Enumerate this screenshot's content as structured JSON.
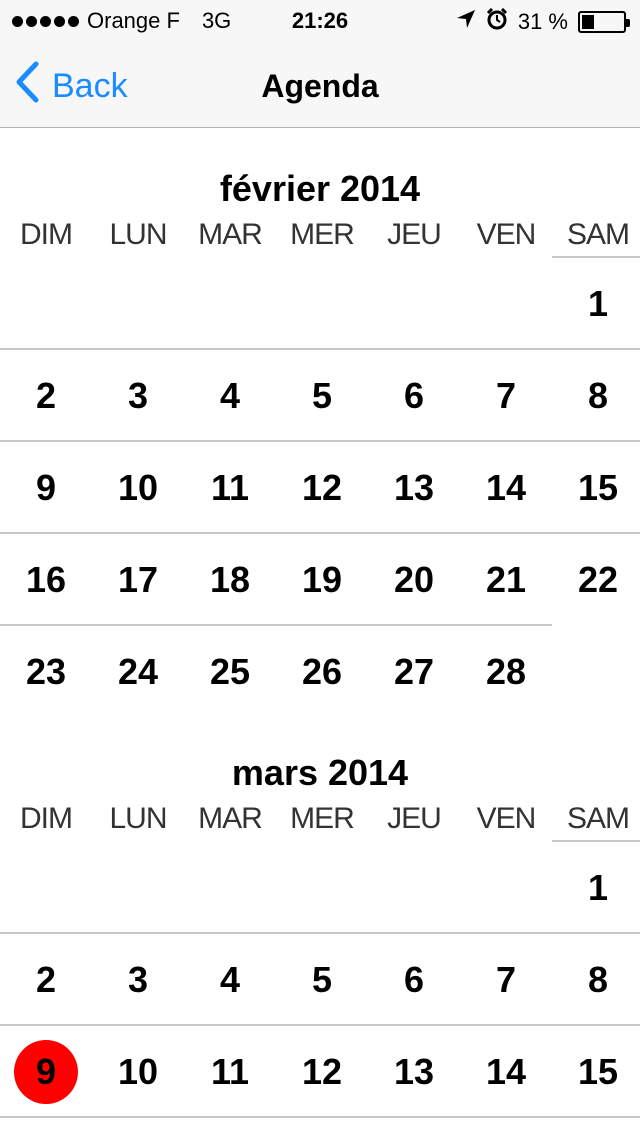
{
  "status": {
    "carrier": "Orange F",
    "network": "3G",
    "time": "21:26",
    "battery": "31 %",
    "battery_level": 0.31,
    "icons": [
      "signal-dots-icon",
      "location-arrow-icon",
      "alarm-clock-icon",
      "battery-icon"
    ]
  },
  "nav": {
    "back_label": "Back",
    "title": "Agenda"
  },
  "weekdays": [
    "DIM",
    "LUN",
    "MAR",
    "MER",
    "JEU",
    "VEN",
    "SAM"
  ],
  "months": [
    {
      "title": "février 2014",
      "first_weekday": 6,
      "days": 28,
      "today": null
    },
    {
      "title": "mars 2014",
      "first_weekday": 6,
      "days": 15,
      "today": 9
    }
  ],
  "colors": {
    "accent": "#1a8cff",
    "today": "#ff0000",
    "separator": "#c8c8c8",
    "bar": "#f7f7f7"
  }
}
